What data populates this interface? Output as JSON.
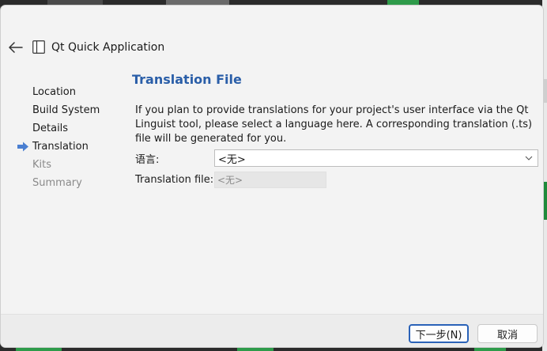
{
  "window": {
    "title": "Qt Quick Application",
    "back_icon": "arrow-left-icon",
    "app_icon": "wizard-app-icon"
  },
  "sidebar": {
    "items": [
      {
        "label": "Location",
        "state": "done"
      },
      {
        "label": "Build System",
        "state": "done"
      },
      {
        "label": "Details",
        "state": "done"
      },
      {
        "label": "Translation",
        "state": "current"
      },
      {
        "label": "Kits",
        "state": "pending"
      },
      {
        "label": "Summary",
        "state": "pending"
      }
    ],
    "current_indicator_icon": "arrow-right-icon",
    "indicator_color": "#4a7fd1"
  },
  "page": {
    "title": "Translation File",
    "title_color": "#2a5ea8",
    "description": "If you plan to provide translations for your project's user interface via the Qt Linguist tool, please select a language here. A corresponding translation (.ts) file will be generated for you."
  },
  "form": {
    "language_label": "语言:",
    "language_value": "<无>",
    "translation_file_label": "Translation file:",
    "translation_file_value": "<无>"
  },
  "buttons": {
    "next_label": "下一步(N)",
    "cancel_label": "取消",
    "accent": "#2a62b8"
  }
}
